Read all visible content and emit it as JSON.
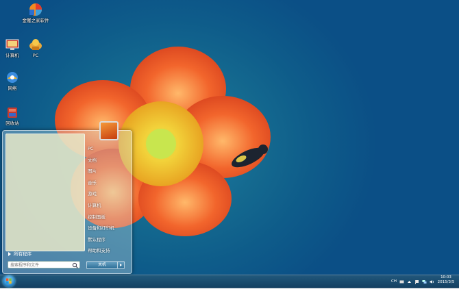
{
  "desktop": {
    "icons": [
      {
        "label": "金蟹之家软件",
        "icon": "software-shortcut-icon"
      },
      {
        "label": "计算机",
        "icon": "computer-icon"
      },
      {
        "label": "PC",
        "icon": "pc-icon"
      },
      {
        "label": "网络",
        "icon": "network-icon"
      },
      {
        "label": "回收站",
        "icon": "recycle-bin-icon"
      }
    ]
  },
  "start_menu": {
    "all_programs": "所有程序",
    "search_placeholder": "搜索程序和文件",
    "right_items": [
      "PC",
      "文档",
      "图片",
      "音乐",
      "游戏",
      "计算机",
      "控制面板",
      "设备和打印机",
      "默认程序",
      "帮助和支持"
    ],
    "shutdown_label": "关机"
  },
  "taskbar": {
    "ime": "CH",
    "time": "10:03",
    "date": "2015/3/5"
  },
  "colors": {
    "accent": "#2b86c8",
    "taskbar": "#1d4a6a",
    "petal": "#f2652c"
  }
}
